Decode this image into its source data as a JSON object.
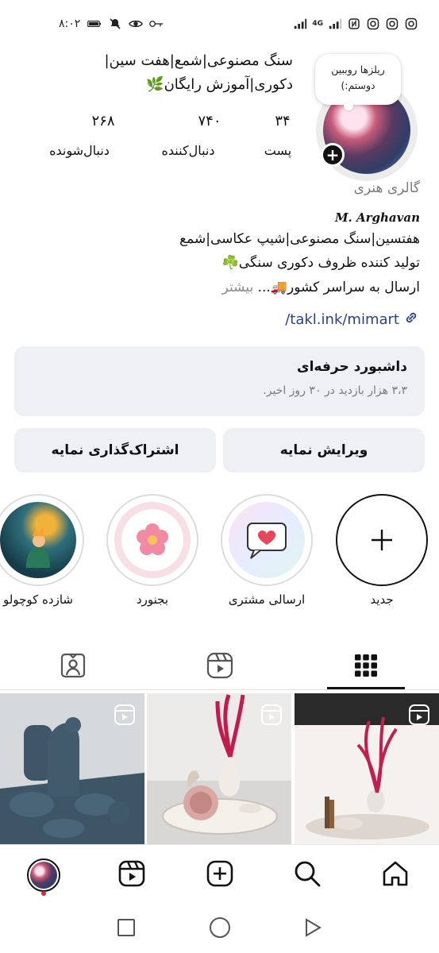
{
  "status_bar": {
    "time": "۸:۰۲",
    "network_label": "4G",
    "left_icons": [
      "battery-icon",
      "mute-icon",
      "eye-icon",
      "key-icon"
    ],
    "right_icons": [
      "signal-icon",
      "signal-icon",
      "nfc-icon",
      "instagram-icon",
      "instagram-icon",
      "instagram-icon"
    ]
  },
  "profile": {
    "note": "ریلزها روببین دوستم:)",
    "name_line_1": "سنگ مصنوعی|شمع|هفت سین|",
    "name_line_2": "دکوری|آموزش رایگان🌿",
    "stats": [
      {
        "value": "۳۴",
        "label": "پست"
      },
      {
        "value": "۷۴۰",
        "label": "دنبال‌کننده"
      },
      {
        "value": "۲۶۸",
        "label": "دنبال‌شونده"
      }
    ],
    "category": "گالری هنری",
    "signature": "M. Arghavan",
    "bio_line_1": "هفتسین|سنگ مصنوعی|شیپ عکاسی|شمع",
    "bio_line_2": "تولید کننده ظروف دکوری سنگی☘️",
    "bio_line_3": "ارسال به سراسر کشور🚚...",
    "bio_more": "بیشتر",
    "link": "/takl.ink/mimart"
  },
  "dashboard": {
    "title": "داشبورد حرفه‌ای",
    "subtitle": "۳،۳ هزار بازدید در ۳۰ روز اخیر."
  },
  "buttons": {
    "edit": "ویرایش نمایه",
    "share": "اشتراک‌گذاری نمایه"
  },
  "highlights": [
    {
      "label": "جدید"
    },
    {
      "label": "ارسالی مشتری"
    },
    {
      "label": "بجنورد"
    },
    {
      "label": "شازده کوچولو"
    }
  ],
  "tabs": [
    "grid-icon",
    "reels-icon",
    "tagged-icon"
  ],
  "colors": {
    "link": "#2c3f8c",
    "muted": "#7a7a7a",
    "card_bg": "#eff0f3",
    "notification_dot": "#e2263c"
  }
}
